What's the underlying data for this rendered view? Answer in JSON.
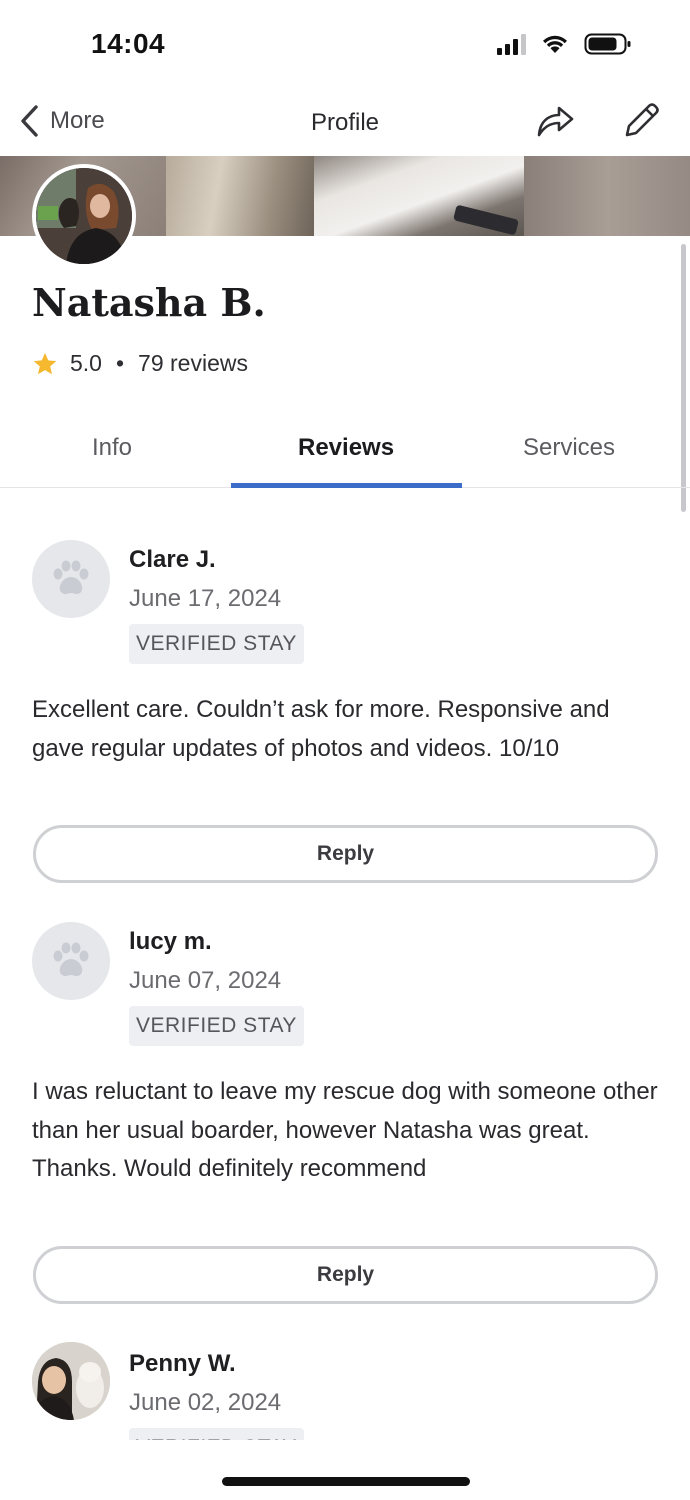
{
  "status_bar": {
    "time": "14:04"
  },
  "nav": {
    "back_label": "More",
    "title": "Profile"
  },
  "profile": {
    "name": "Natasha B.",
    "rating": "5.0",
    "separator": "•",
    "reviews_count": "79 reviews"
  },
  "tabs": [
    {
      "label": "Info"
    },
    {
      "label": "Reviews"
    },
    {
      "label": "Services"
    }
  ],
  "active_tab": "Reviews",
  "reviews": [
    {
      "name": "Clare J.",
      "date": "June 17, 2024",
      "badge": "VERIFIED STAY",
      "text": "Excellent care. Couldn’t ask for more. Responsive and gave regular updates of photos and videos. 10/10",
      "reply_label": "Reply",
      "avatar": "paw-icon"
    },
    {
      "name": "lucy m.",
      "date": "June 07, 2024",
      "badge": "VERIFIED STAY",
      "text": "I was reluctant to leave my rescue dog with someone other than her usual boarder, however Natasha was great. Thanks. Would definitely recommend",
      "reply_label": "Reply",
      "avatar": "paw-icon"
    },
    {
      "name": "Penny W.",
      "date": "June 02, 2024",
      "badge": "VERIFIED STAY",
      "avatar": "photo"
    }
  ],
  "colors": {
    "accent": "#3b6cc7",
    "star": "#f5b82e",
    "verified_bg": "#eeeff2"
  }
}
